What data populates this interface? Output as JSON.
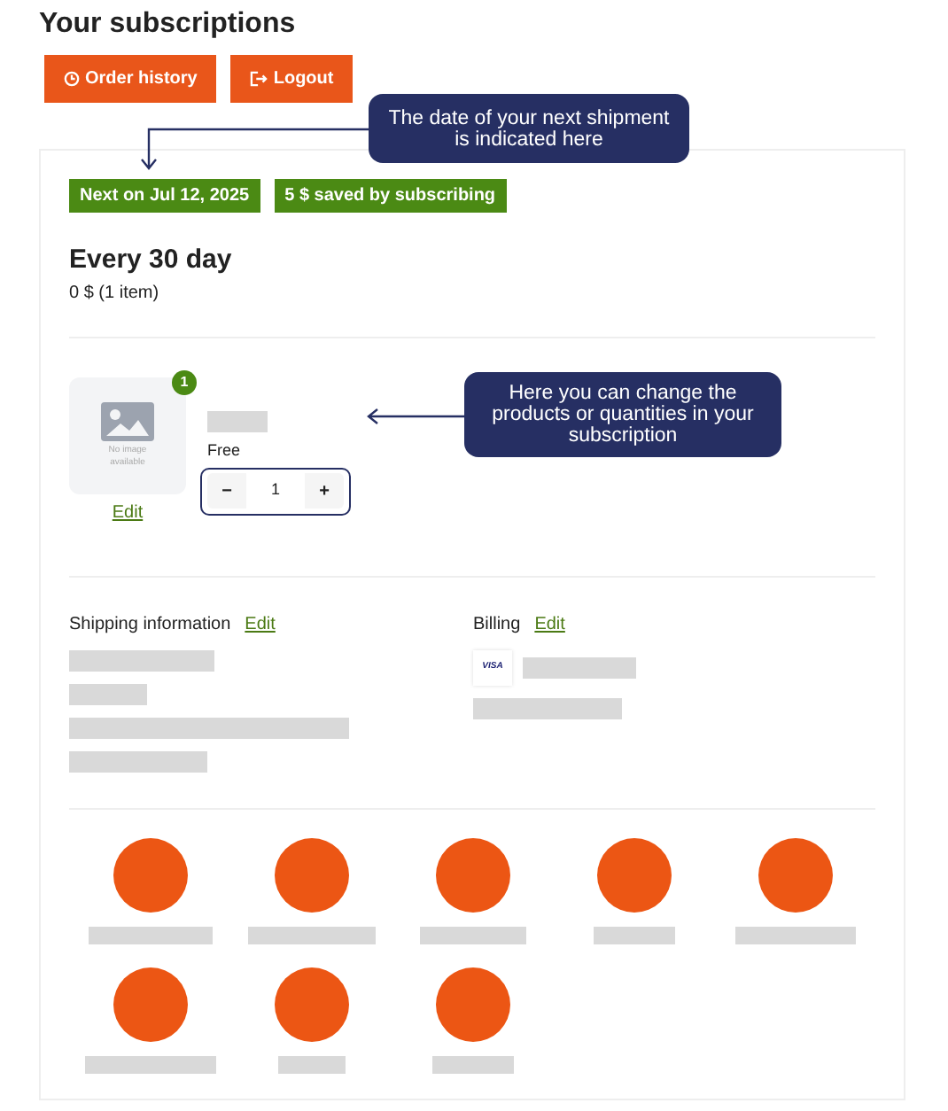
{
  "page": {
    "title": "Your subscriptions"
  },
  "buttons": [
    {
      "kind": "history",
      "label": "Order history"
    },
    {
      "kind": "logout",
      "label": "Logout"
    }
  ],
  "badges": [
    "Next on Jul 12, 2025",
    "5 $ saved by subscribing"
  ],
  "subscription": {
    "title": "Every 30 day",
    "summary": "0 $ (1 item)"
  },
  "product": {
    "image_text": "No image available",
    "count": "1",
    "edit": "Edit",
    "price": "Free",
    "minus": "−",
    "quantity": "1",
    "plus": "+"
  },
  "shipping": {
    "label": "Shipping information",
    "edit": "Edit"
  },
  "billing": {
    "label": "Billing",
    "edit": "Edit",
    "card": "VISA"
  },
  "callouts": [
    {
      "text": "The date of your next shipment is indicated here"
    },
    {
      "text": "Here you can change the products or quantities in your subscription"
    }
  ]
}
